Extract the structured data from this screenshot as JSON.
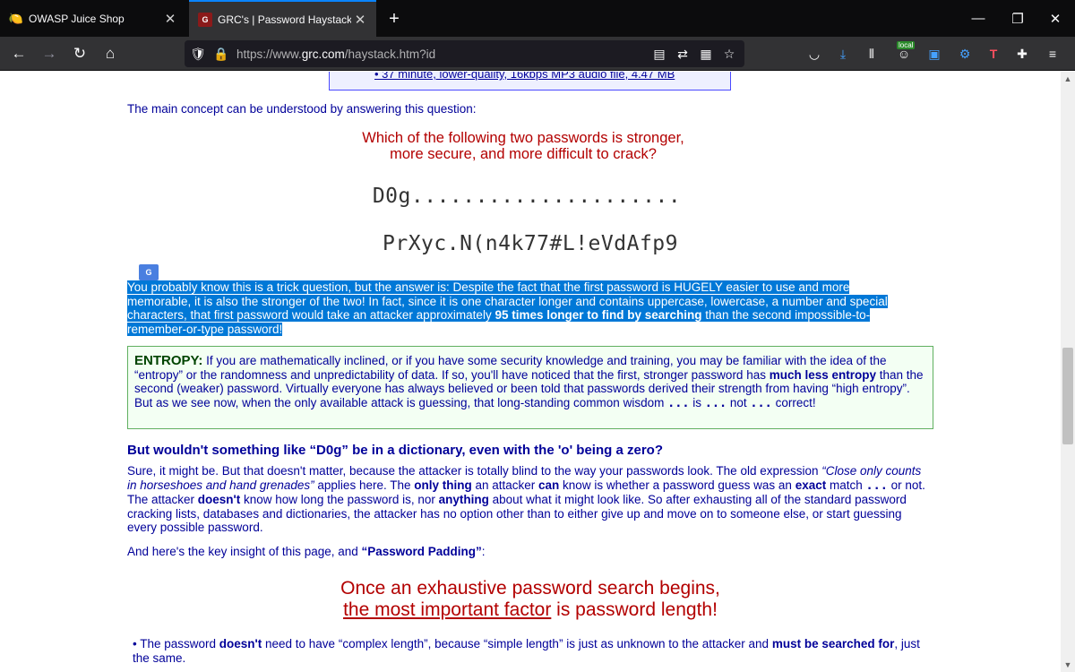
{
  "browser": {
    "tabs": [
      {
        "title": "OWASP Juice Shop"
      },
      {
        "title": "GRC's | Password Haystacks: Ho"
      }
    ],
    "url_prefix": "https://www.",
    "url_domain": "grc.com",
    "url_path": "/haystack.htm?id",
    "local_badge": "local"
  },
  "page": {
    "media_item": "• 37 minute, lower-quality, 16kbps MP3 audio file, 4.47 MB",
    "lead": "The main concept can be understood by answering this question:",
    "question_line1": "Which of the following two passwords is stronger,",
    "question_line2": "more secure, and more difficult to crack?",
    "password1": "D0g.....................",
    "password2": "PrXyc.N(n4k77#L!eVdAfp9",
    "answer_part1": "You probably know this is a trick question, but the answer is: Despite the fact that the first password is HUGELY easier to use and more memorable, it is also the stronger of the two! In fact, since it is one character longer and contains uppercase, lowercase, a number and special characters, that first password would take an attacker approximately ",
    "answer_bold": "95 times longer to find by searching",
    "answer_part2": " than the second impossible-to-remember-or-type password!",
    "entropy_label": "ENTROPY:",
    "entropy_part1": " If you are mathematically inclined, or if you have some security knowledge and training, you may be familiar with the idea of the “entropy” or the randomness and unpredictability of data. If so, you'll have noticed that the first, stronger password has ",
    "entropy_bold1": "much less entropy",
    "entropy_part2": " than the second (weaker) password. Virtually everyone has always believed or been told that passwords derived their strength from having “high entropy”. But as we see now, when the only available attack is guessing, that long-standing common wisdom ",
    "entropy_dots1": "...",
    "entropy_is": " is ",
    "entropy_dots2": "...",
    "entropy_not": " not ",
    "entropy_dots3": "...",
    "entropy_correct": " correct!",
    "heading": "But wouldn't something like “D0g” be in a dictionary, even with the 'o' being a zero?",
    "p2_a": "Sure, it might be. But that doesn't matter, because the attacker is totally blind to the way your passwords look. The old expression ",
    "p2_quote": "“Close only counts in horseshoes and hand grenades”",
    "p2_b": " applies here. The ",
    "p2_only": "only thing",
    "p2_c": " an attacker ",
    "p2_can": "can",
    "p2_d": " know is whether a password guess was an ",
    "p2_exact": "exact",
    "p2_e": " match ",
    "p2_dots": "...",
    "p2_f": " or not. The attacker ",
    "p2_doesnt": "doesn't",
    "p2_g": " know how long the password is, nor ",
    "p2_anything": "anything",
    "p2_h": " about what it might look like. So after exhausting all of the standard password cracking lists, databases and dictionaries, the attacker has no option other than to either give up and move on to someone else, or start guessing every possible password.",
    "p3_a": "And here's the key insight of this page, and ",
    "p3_bold": "“Password Padding”",
    "p3_b": ":",
    "big1": "Once an exhaustive password search begins,",
    "big2_u": "the most important factor",
    "big2_rest": " is password length!",
    "bullet_a": "The password ",
    "bullet_doesnt": "doesn't",
    "bullet_b": " need to have “complex length”, because “simple length” is just as unknown to the attacker and ",
    "bullet_must": "must be searched for",
    "bullet_c": ", just the same."
  }
}
